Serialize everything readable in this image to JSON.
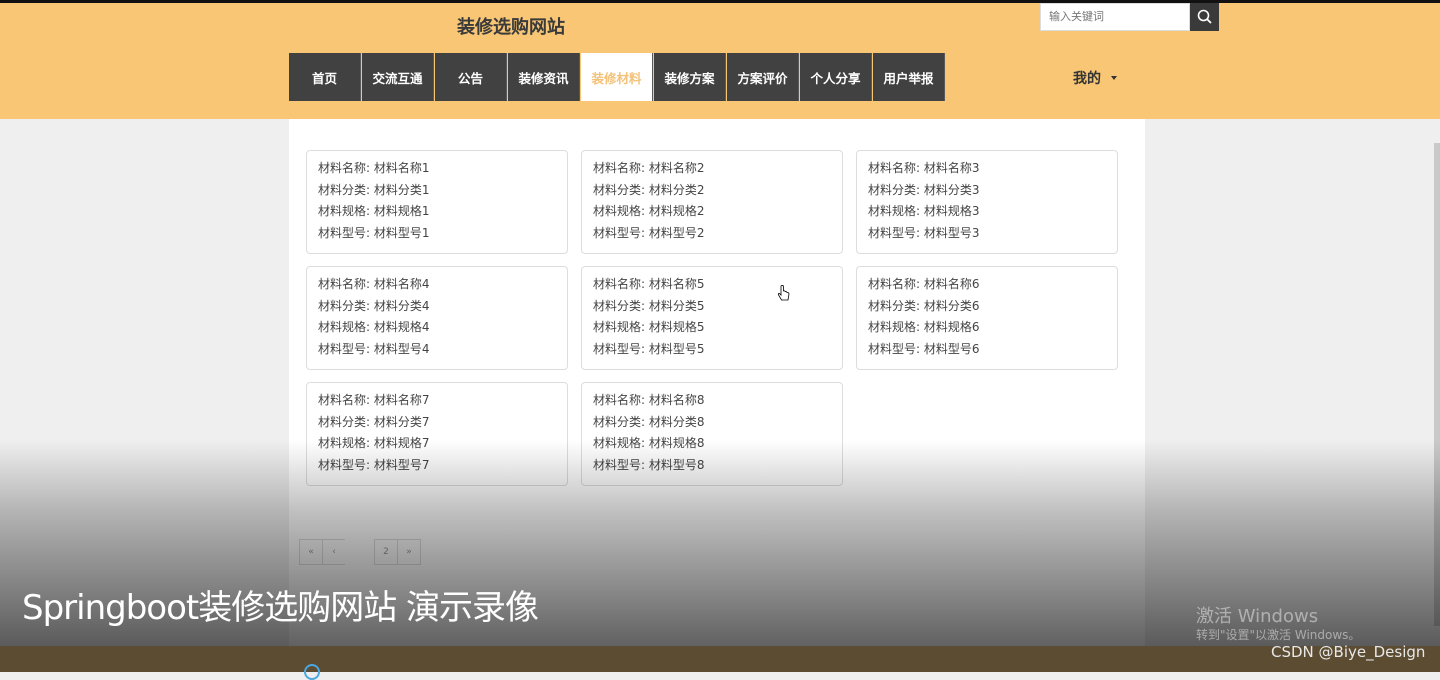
{
  "header": {
    "site_title": "装修选购网站",
    "search_placeholder": "输入关键词",
    "mine_label": "我的"
  },
  "nav": {
    "items": [
      {
        "label": "首页"
      },
      {
        "label": "交流互通"
      },
      {
        "label": "公告"
      },
      {
        "label": "装修资讯"
      },
      {
        "label": "装修材料"
      },
      {
        "label": "装修方案"
      },
      {
        "label": "方案评价"
      },
      {
        "label": "个人分享"
      },
      {
        "label": "用户举报"
      }
    ],
    "active_label": "装修材料"
  },
  "materials": [
    {
      "name": "材料名称: 材料名称1",
      "category": "材料分类: 材料分类1",
      "spec": "材料规格: 材料规格1",
      "model": "材料型号: 材料型号1"
    },
    {
      "name": "材料名称: 材料名称2",
      "category": "材料分类: 材料分类2",
      "spec": "材料规格: 材料规格2",
      "model": "材料型号: 材料型号2"
    },
    {
      "name": "材料名称: 材料名称3",
      "category": "材料分类: 材料分类3",
      "spec": "材料规格: 材料规格3",
      "model": "材料型号: 材料型号3"
    },
    {
      "name": "材料名称: 材料名称4",
      "category": "材料分类: 材料分类4",
      "spec": "材料规格: 材料规格4",
      "model": "材料型号: 材料型号4"
    },
    {
      "name": "材料名称: 材料名称5",
      "category": "材料分类: 材料分类5",
      "spec": "材料规格: 材料规格5",
      "model": "材料型号: 材料型号5"
    },
    {
      "name": "材料名称: 材料名称6",
      "category": "材料分类: 材料分类6",
      "spec": "材料规格: 材料规格6",
      "model": "材料型号: 材料型号6"
    },
    {
      "name": "材料名称: 材料名称7",
      "category": "材料分类: 材料分类7",
      "spec": "材料规格: 材料规格7",
      "model": "材料型号: 材料型号7"
    },
    {
      "name": "材料名称: 材料名称8",
      "category": "材料分类: 材料分类8",
      "spec": "材料规格: 材料规格8",
      "model": "材料型号: 材料型号8"
    }
  ],
  "pagination": {
    "first": "«",
    "prev": "‹",
    "page": "2",
    "next": "»"
  },
  "overlay": {
    "video_title": "Springboot装修选购网站 演示录像",
    "windows_line1": "激活 Windows",
    "windows_line2": "转到\"设置\"以激活 Windows。",
    "credit": "CSDN @Biye_Design"
  },
  "colors": {
    "header_bg": "#f8c674",
    "nav_bg": "#414141",
    "nav_active_text": "#f3c27a"
  },
  "icons": {
    "search": "search-icon",
    "caret": "caret-down-icon",
    "cursor": "hand-pointer-icon"
  }
}
